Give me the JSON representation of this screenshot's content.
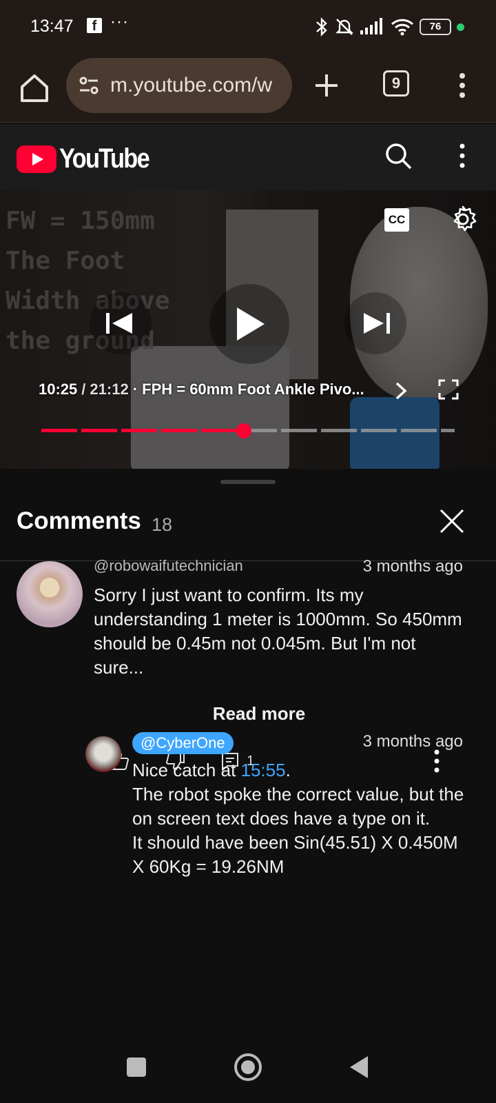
{
  "status_bar": {
    "time": "13:47",
    "fb_glyph": "f",
    "more_glyph": "···",
    "battery": "76",
    "icons": [
      "bluetooth-icon",
      "muted-bell-icon",
      "signal-icon",
      "wifi-icon",
      "battery-icon"
    ],
    "dot_color": "#2ecc71"
  },
  "browser": {
    "url": "m.youtube.com/w",
    "tab_count": "9"
  },
  "youtube": {
    "brand": "YouTube",
    "brand_color": "#ff0033"
  },
  "player": {
    "cc_label": "CC",
    "overlay_text": [
      "FW = 150mm",
      "The Foot",
      "Width above",
      "the ground"
    ],
    "current_time": "10:25",
    "separator": "/",
    "duration": "21:12",
    "chapter": "· FPH = 60mm Foot Ankle Pivo...",
    "progress": 0.49
  },
  "comments": {
    "title": "Comments",
    "count": "18",
    "items": [
      {
        "author": "@robowaifutechnician",
        "time": "3 months ago",
        "text": "Sorry I just want to confirm. Its my understanding 1 meter is 1000mm. So 450mm should be 0.45m not 0.045m. But I'm not sure...",
        "read_more": "Read more",
        "reply_count": "1"
      }
    ],
    "reply": {
      "author": "@CyberOne",
      "time": "3 months ago",
      "text_before": "Nice catch at ",
      "timestamp_link": "15:55",
      "text_after": ".",
      "lines": [
        "The robot spoke the correct value, but the on screen text does have a type on it.",
        "It should have been Sin(45.51) X 0.450M X 60Kg = 19.26NM"
      ],
      "link_color": "#3ea6ff"
    }
  }
}
